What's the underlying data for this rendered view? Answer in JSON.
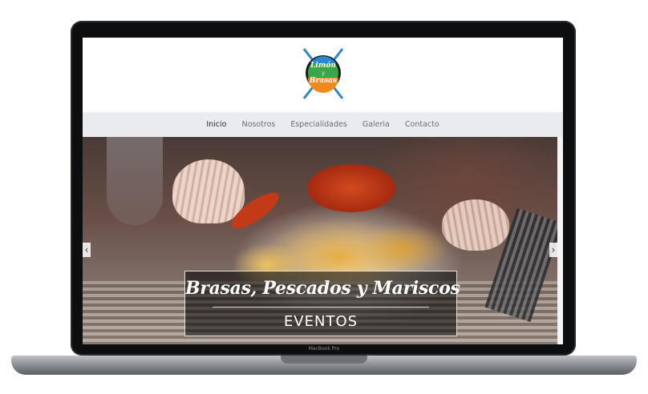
{
  "device": {
    "model_label": "MacBook Pro"
  },
  "site": {
    "logo": {
      "line1": "Limón",
      "line2": "y",
      "line3": "Brasas"
    },
    "nav": [
      {
        "label": "Inicio",
        "active": true
      },
      {
        "label": "Nosotros",
        "active": false
      },
      {
        "label": "Especialidades",
        "active": false
      },
      {
        "label": "Galeria",
        "active": false
      },
      {
        "label": "Contacto",
        "active": false
      }
    ],
    "hero": {
      "title": "Brasas, Pescados y Mariscos",
      "subtitle": "EVENTOS",
      "prev": "‹",
      "next": "›"
    }
  },
  "colors": {
    "nav_bg": "#e9ebef",
    "nav_text": "#6b6f76",
    "caption_bg": "#000000",
    "bezel": "#0d0e10",
    "logo_green": "#3aa64a",
    "logo_blue": "#2c88c7",
    "logo_orange": "#f08a1c"
  }
}
